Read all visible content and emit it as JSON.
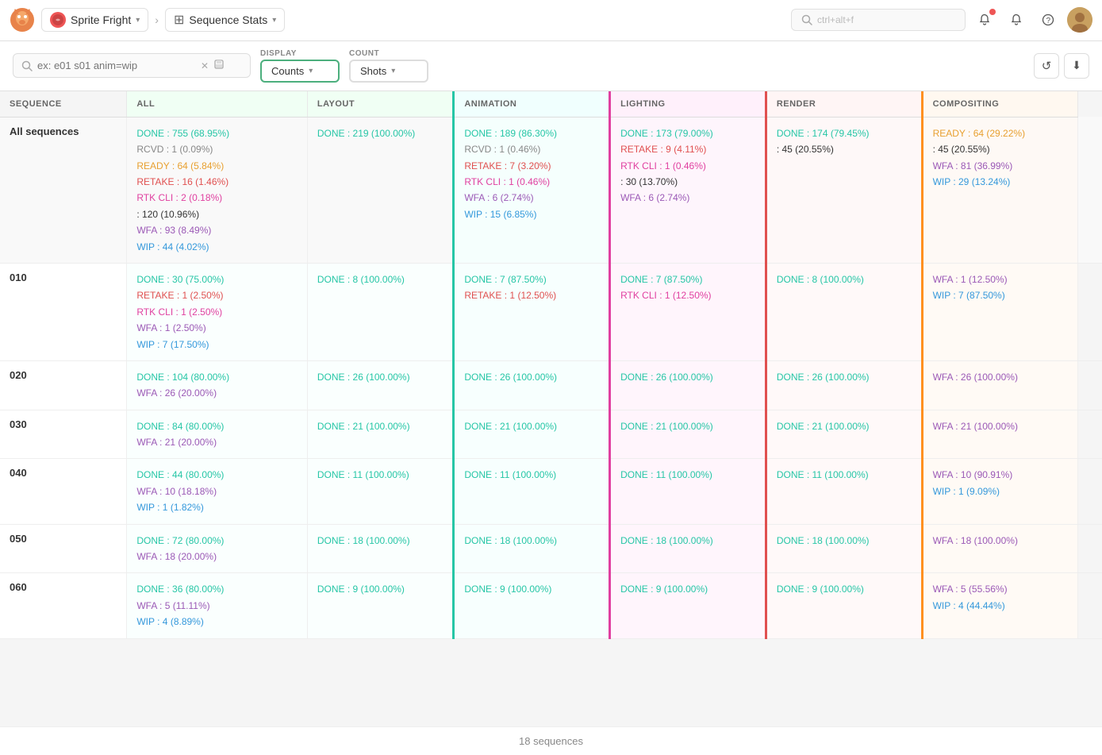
{
  "topnav": {
    "logo_alt": "Kitsu",
    "project_name": "Sprite Fright",
    "breadcrumb_arrow": "›",
    "page_title": "Sequence Stats",
    "search_placeholder": "ctrl+alt+f",
    "icons": {
      "notifications": "🔔",
      "bell": "🔔",
      "help": "?"
    }
  },
  "toolbar": {
    "filter_placeholder": "ex: e01 s01 anim=wip",
    "display_label": "DISPLAY",
    "count_label": "COUNT",
    "counts_btn": "Counts",
    "shots_btn": "Shots",
    "reload_icon": "↺",
    "download_icon": "⬇"
  },
  "table": {
    "columns": [
      {
        "id": "sequence",
        "label": "SEQUENCE",
        "class": ""
      },
      {
        "id": "all",
        "label": "ALL",
        "class": "col-all"
      },
      {
        "id": "layout",
        "label": "LAYOUT",
        "class": "col-layout"
      },
      {
        "id": "animation",
        "label": "ANIMATION",
        "class": "col-animation"
      },
      {
        "id": "lighting",
        "label": "LIGHTING",
        "class": "col-lighting"
      },
      {
        "id": "render",
        "label": "RENDER",
        "class": "col-render"
      },
      {
        "id": "compositing",
        "label": "COMPOSITING",
        "class": "col-compositing"
      }
    ],
    "rows": [
      {
        "id": "all-sequences",
        "sequence": "All sequences",
        "is_all": true,
        "all": [
          {
            "cls": "done",
            "text": "DONE : 755 (68.95%)"
          },
          {
            "cls": "rcvd",
            "text": "RCVD : 1 (0.09%)"
          },
          {
            "cls": "ready",
            "text": "READY : 64 (5.84%)"
          },
          {
            "cls": "retake",
            "text": "RETAKE : 16 (1.46%)"
          },
          {
            "cls": "rtk-cli",
            "text": "RTK CLI : 2 (0.18%)"
          },
          {
            "cls": "blank",
            "text": ": 120 (10.96%)"
          },
          {
            "cls": "wfa",
            "text": "WFA : 93 (8.49%)"
          },
          {
            "cls": "wip",
            "text": "WIP : 44 (4.02%)"
          }
        ],
        "layout": [
          {
            "cls": "done",
            "text": "DONE : 219 (100.00%)"
          }
        ],
        "animation": [
          {
            "cls": "done",
            "text": "DONE : 189 (86.30%)"
          },
          {
            "cls": "rcvd",
            "text": "RCVD : 1 (0.46%)"
          },
          {
            "cls": "retake",
            "text": "RETAKE : 7 (3.20%)"
          },
          {
            "cls": "rtk-cli",
            "text": "RTK CLI : 1 (0.46%)"
          },
          {
            "cls": "wfa",
            "text": "WFA : 6 (2.74%)"
          },
          {
            "cls": "wip",
            "text": "WIP : 15 (6.85%)"
          }
        ],
        "lighting": [
          {
            "cls": "done",
            "text": "DONE : 173 (79.00%)"
          },
          {
            "cls": "retake",
            "text": "RETAKE : 9 (4.11%)"
          },
          {
            "cls": "rtk-cli",
            "text": "RTK CLI : 1 (0.46%)"
          },
          {
            "cls": "blank",
            "text": ": 30 (13.70%)"
          },
          {
            "cls": "wfa",
            "text": "WFA : 6 (2.74%)"
          }
        ],
        "render": [
          {
            "cls": "done",
            "text": "DONE : 174 (79.45%)"
          },
          {
            "cls": "blank",
            "text": ": 45 (20.55%)"
          }
        ],
        "compositing": [
          {
            "cls": "ready",
            "text": "READY : 64 (29.22%)"
          },
          {
            "cls": "blank",
            "text": ": 45 (20.55%)"
          },
          {
            "cls": "wfa",
            "text": "WFA : 81 (36.99%)"
          },
          {
            "cls": "wip",
            "text": "WIP : 29 (13.24%)"
          }
        ]
      },
      {
        "id": "010",
        "sequence": "010",
        "is_all": false,
        "all": [
          {
            "cls": "done",
            "text": "DONE : 30 (75.00%)"
          },
          {
            "cls": "retake",
            "text": "RETAKE : 1 (2.50%)"
          },
          {
            "cls": "rtk-cli",
            "text": "RTK CLI : 1 (2.50%)"
          },
          {
            "cls": "wfa",
            "text": "WFA : 1 (2.50%)"
          },
          {
            "cls": "wip",
            "text": "WIP : 7 (17.50%)"
          }
        ],
        "layout": [
          {
            "cls": "done",
            "text": "DONE : 8 (100.00%)"
          }
        ],
        "animation": [
          {
            "cls": "done",
            "text": "DONE : 7 (87.50%)"
          },
          {
            "cls": "retake",
            "text": "RETAKE : 1 (12.50%)"
          }
        ],
        "lighting": [
          {
            "cls": "done",
            "text": "DONE : 7 (87.50%)"
          },
          {
            "cls": "rtk-cli",
            "text": "RTK CLI : 1 (12.50%)"
          }
        ],
        "render": [
          {
            "cls": "done",
            "text": "DONE : 8 (100.00%)"
          }
        ],
        "compositing": [
          {
            "cls": "wfa",
            "text": "WFA : 1 (12.50%)"
          },
          {
            "cls": "wip",
            "text": "WIP : 7 (87.50%)"
          }
        ]
      },
      {
        "id": "020",
        "sequence": "020",
        "is_all": false,
        "all": [
          {
            "cls": "done",
            "text": "DONE : 104 (80.00%)"
          },
          {
            "cls": "wfa",
            "text": "WFA : 26 (20.00%)"
          }
        ],
        "layout": [
          {
            "cls": "done",
            "text": "DONE : 26 (100.00%)"
          }
        ],
        "animation": [
          {
            "cls": "done",
            "text": "DONE : 26 (100.00%)"
          }
        ],
        "lighting": [
          {
            "cls": "done",
            "text": "DONE : 26 (100.00%)"
          }
        ],
        "render": [
          {
            "cls": "done",
            "text": "DONE : 26 (100.00%)"
          }
        ],
        "compositing": [
          {
            "cls": "wfa",
            "text": "WFA : 26 (100.00%)"
          }
        ]
      },
      {
        "id": "030",
        "sequence": "030",
        "is_all": false,
        "all": [
          {
            "cls": "done",
            "text": "DONE : 84 (80.00%)"
          },
          {
            "cls": "wfa",
            "text": "WFA : 21 (20.00%)"
          }
        ],
        "layout": [
          {
            "cls": "done",
            "text": "DONE : 21 (100.00%)"
          }
        ],
        "animation": [
          {
            "cls": "done",
            "text": "DONE : 21 (100.00%)"
          }
        ],
        "lighting": [
          {
            "cls": "done",
            "text": "DONE : 21 (100.00%)"
          }
        ],
        "render": [
          {
            "cls": "done",
            "text": "DONE : 21 (100.00%)"
          }
        ],
        "compositing": [
          {
            "cls": "wfa",
            "text": "WFA : 21 (100.00%)"
          }
        ]
      },
      {
        "id": "040",
        "sequence": "040",
        "is_all": false,
        "all": [
          {
            "cls": "done",
            "text": "DONE : 44 (80.00%)"
          },
          {
            "cls": "wfa",
            "text": "WFA : 10 (18.18%)"
          },
          {
            "cls": "wip",
            "text": "WIP : 1 (1.82%)"
          }
        ],
        "layout": [
          {
            "cls": "done",
            "text": "DONE : 11 (100.00%)"
          }
        ],
        "animation": [
          {
            "cls": "done",
            "text": "DONE : 11 (100.00%)"
          }
        ],
        "lighting": [
          {
            "cls": "done",
            "text": "DONE : 11 (100.00%)"
          }
        ],
        "render": [
          {
            "cls": "done",
            "text": "DONE : 11 (100.00%)"
          }
        ],
        "compositing": [
          {
            "cls": "wfa",
            "text": "WFA : 10 (90.91%)"
          },
          {
            "cls": "wip",
            "text": "WIP : 1 (9.09%)"
          }
        ]
      },
      {
        "id": "050",
        "sequence": "050",
        "is_all": false,
        "all": [
          {
            "cls": "done",
            "text": "DONE : 72 (80.00%)"
          },
          {
            "cls": "wfa",
            "text": "WFA : 18 (20.00%)"
          }
        ],
        "layout": [
          {
            "cls": "done",
            "text": "DONE : 18 (100.00%)"
          }
        ],
        "animation": [
          {
            "cls": "done",
            "text": "DONE : 18 (100.00%)"
          }
        ],
        "lighting": [
          {
            "cls": "done",
            "text": "DONE : 18 (100.00%)"
          }
        ],
        "render": [
          {
            "cls": "done",
            "text": "DONE : 18 (100.00%)"
          }
        ],
        "compositing": [
          {
            "cls": "wfa",
            "text": "WFA : 18 (100.00%)"
          }
        ]
      },
      {
        "id": "060",
        "sequence": "060",
        "is_all": false,
        "all": [
          {
            "cls": "done",
            "text": "DONE : 36 (80.00%)"
          },
          {
            "cls": "wfa",
            "text": "WFA : 5 (11.11%)"
          },
          {
            "cls": "wip",
            "text": "WIP : 4 (8.89%)"
          }
        ],
        "layout": [
          {
            "cls": "done",
            "text": "DONE : 9 (100.00%)"
          }
        ],
        "animation": [
          {
            "cls": "done",
            "text": "DONE : 9 (100.00%)"
          }
        ],
        "lighting": [
          {
            "cls": "done",
            "text": "DONE : 9 (100.00%)"
          }
        ],
        "render": [
          {
            "cls": "done",
            "text": "DONE : 9 (100.00%)"
          }
        ],
        "compositing": [
          {
            "cls": "wfa",
            "text": "WFA : 5 (55.56%)"
          },
          {
            "cls": "wip",
            "text": "WIP : 4 (44.44%)"
          }
        ]
      }
    ]
  },
  "footer": {
    "label": "18 sequences"
  }
}
